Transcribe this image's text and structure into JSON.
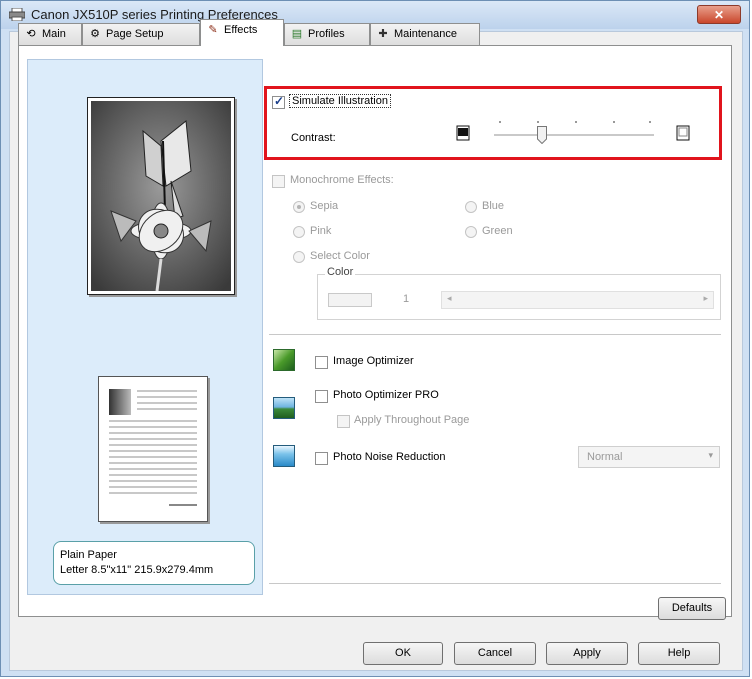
{
  "window": {
    "title": "Canon JX510P series Printing Preferences",
    "close_symbol": "✕"
  },
  "tabs": [
    {
      "label": "Main",
      "icon": "main-tab-icon",
      "active": false
    },
    {
      "label": "Page Setup",
      "icon": "page-setup-icon",
      "active": false
    },
    {
      "label": "Effects",
      "icon": "effects-brush-icon",
      "active": true
    },
    {
      "label": "Profiles",
      "icon": "profiles-icon",
      "active": false
    },
    {
      "label": "Maintenance",
      "icon": "maintenance-icon",
      "active": false
    }
  ],
  "simulate_illustration": {
    "label": "Simulate Illustration",
    "checked": true
  },
  "contrast": {
    "label": "Contrast:",
    "level": 0.3
  },
  "monochrome_effects": {
    "label": "Monochrome Effects:",
    "checked": false,
    "options": {
      "sepia": "Sepia",
      "blue": "Blue",
      "pink": "Pink",
      "green": "Green",
      "select_color": "Select Color"
    },
    "selected": "Sepia",
    "color_group_label": "Color",
    "color_value": "1"
  },
  "image_optimizer": {
    "label": "Image Optimizer",
    "checked": false
  },
  "photo_optimizer_pro": {
    "label": "Photo Optimizer PRO",
    "checked": false
  },
  "apply_throughout_page": {
    "label": "Apply Throughout Page",
    "checked": false
  },
  "photo_noise_reduction": {
    "label": "Photo Noise Reduction",
    "checked": false,
    "level": "Normal"
  },
  "paper": {
    "type": "Plain Paper",
    "size": "Letter 8.5\"x11\" 215.9x279.4mm"
  },
  "buttons": {
    "defaults": "Defaults",
    "ok": "OK",
    "cancel": "Cancel",
    "apply": "Apply",
    "help": "Help"
  },
  "colors": {
    "highlight": "#e1141c",
    "panel_blue": "#dcecfa"
  }
}
